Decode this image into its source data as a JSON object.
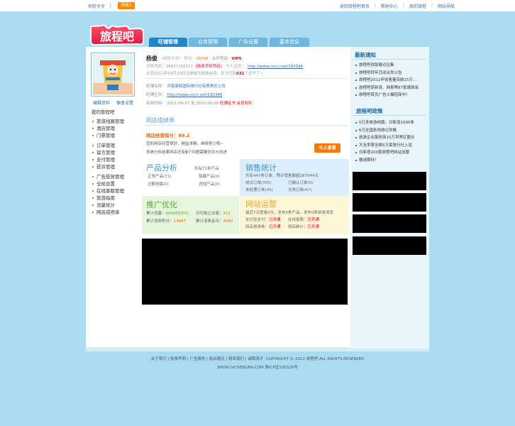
{
  "topbar": {
    "user": "何铃令令",
    "badge": "消息1",
    "links": [
      "返回旅程吧首页",
      "帮助中心",
      "我的旅程",
      "网站导航"
    ]
  },
  "logo_text": "旅程吧",
  "tabs": [
    "旺铺管理",
    "业务管理",
    "广告设置",
    "基本信息"
  ],
  "left": {
    "edit_profile": "编辑资料",
    "avatar_settings": "像册设置",
    "heading": "我的旅程吧",
    "items": [
      "旅游线路管理",
      "酒店管理",
      "门票管理",
      "",
      "订单管理",
      "留言管理",
      "支付管理",
      "投诉管理",
      "",
      "广告投放管理",
      "全局设置",
      "在线客服管理",
      "旅游指南",
      "流量统计",
      "网店成绩单"
    ]
  },
  "profile": {
    "name": "杨俊",
    "account": "(何铃令令)",
    "points_label": "积分：",
    "points": "15016",
    "level_label": "会员等级：",
    "level": "VIP5",
    "phone_label": "手机号码：",
    "phone": "18037180111",
    "change_phone": "[修改手机号码]",
    "homepage_label": "个人主页：",
    "homepage": "http://www.cncn.net/190346",
    "reg_prefix": "从您2011年09月29日注册成为旅游会员，至今已有",
    "reg_days": "631",
    "reg_suffix": "个日子了~"
  },
  "shop": {
    "name_label": "旺铺名称：",
    "name": "河南康辉国际旅行社有限责任公司",
    "homepage_label": "旺铺主页：",
    "homepage": "http://www.cncn.net/190346",
    "valid_label": "有效时间：",
    "valid": "2011-09-27 至 2013-09-26",
    "cert1": "旺铺证书",
    "cert2": "会员权利"
  },
  "growth": {
    "title": "网店成绩单",
    "score_label": "网店经营指分：",
    "score": "89.2",
    "desc1": "您的网店经营很好，精益求精，继续努力哦~",
    "desc2_prefix": "系统分析结果网店还有",
    "desc2_num": "5",
    "desc2_suffix": "个问题需要优化与改进",
    "button": "马上查看"
  },
  "products": {
    "title": "产品分析",
    "total": "共有71条产品",
    "normal": "正常产品(71)",
    "hidden": "隐藏产品(0)",
    "expired": "过期线路(0)",
    "violation": "违规产品(0)"
  },
  "sales": {
    "title": "销售统计",
    "summary": "共有447条订单，预计销售额超287044元",
    "done": "成交订单(355)",
    "confirmed": "已确认订单(0)",
    "unprocessed": "未处理订单(45)",
    "invalid": "无效订单(47)"
  },
  "promo": {
    "title": "推广优化",
    "pv_label": "累计流量：",
    "pv": "406855(PV)",
    "daily_label": "日均独立访客：",
    "daily": "412",
    "points_label": "累计消费积分：",
    "points": "13687",
    "coins_label": "累计消费金币：",
    "coins": "4060"
  },
  "ops": {
    "title": "网站运营",
    "desc": "最近7天登录0次，发布0条产品，发布0条新游消息",
    "pay_label": "支付宝支付：",
    "pay_val": "已开通",
    "online_label": "在线客服：",
    "online_val": "已开通",
    "tour_label": "网店旅游券：",
    "tour_val": "已开通",
    "stats_label": "网店统计：",
    "stats_val": "已开通"
  },
  "right": {
    "news_title": "最新通知",
    "news": [
      "旅程吧改版建议征集",
      "旅程吧拜年活动派发公告",
      "旅程吧2012年收客量突破15万…",
      "旅程吧获新浪、网易等87家媒体采",
      "旅程吧首页广告火爆招商中！"
    ],
    "policy_title": "旅程吧政策",
    "policy": [
      "0万多旅游线路，日新增1000条",
      "6万全国各地游记攻略",
      "旅游企业服务商10万世界区盟点",
      "大全率客全面5万家旅行社入驻",
      "日新增100家旅程吧网站加盟",
      "敬请期待！"
    ]
  },
  "footer": {
    "links": [
      "关于我们",
      "免责声明",
      "广告服务",
      "投诉建议",
      "联系我们",
      "诚聘英才"
    ],
    "copyright": "COPYRIGHT © 2012 旅程吧 ALL RIGHTS RESERVED",
    "icp": "WWW.LVCHENGBA.COM 豫ICP证100328号"
  }
}
